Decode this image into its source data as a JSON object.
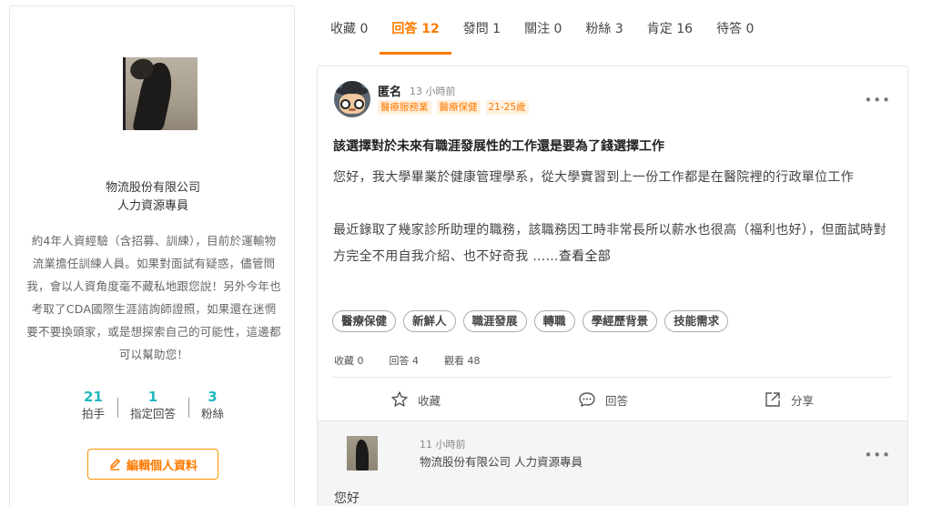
{
  "profile": {
    "company": "物流股份有限公司",
    "title": "人力資源專員",
    "bio": "約4年人資經驗（含招募、訓練），目前於運輸物流業擔任訓練人員。如果對面試有疑惑，儘管問我，會以人資角度毫不藏私地跟您說！另外今年也考取了CDA國際生涯諮詢師證照，如果還在迷惘要不要換頭家，或是想探索自己的可能性，這邊都可以幫助您！",
    "stats": [
      {
        "value": "21",
        "label": "拍手"
      },
      {
        "value": "1",
        "label": "指定回答"
      },
      {
        "value": "3",
        "label": "粉絲"
      }
    ],
    "edit_label": "編輯個人資料",
    "accent": "#21b8c1",
    "brand": "#ff7a00"
  },
  "tabs": [
    {
      "label": "收藏 0"
    },
    {
      "label": "回答 12",
      "active": true
    },
    {
      "label": "發問 1"
    },
    {
      "label": "關注 0"
    },
    {
      "label": "粉絲 3"
    },
    {
      "label": "肯定 16"
    },
    {
      "label": "待答 0"
    }
  ],
  "post": {
    "author": "匿名",
    "time": "13 小時前",
    "author_tags": [
      "醫療服務業",
      "醫療保健",
      "21-25歲"
    ],
    "title": "該選擇對於未來有職涯發展性的工作還是要為了錢選擇工作",
    "body_p1": "您好，我大學畢業於健康管理學系，從大學實習到上一份工作都是在醫院裡的行政單位工作",
    "body_p2": "最近錄取了幾家診所助理的職務，該職務因工時非常長所以薪水也很高（福利也好），但面試時對方完全不用自我介紹、也不好奇我 ……",
    "see_all": "查看全部",
    "topics": [
      "醫療保健",
      "新鮮人",
      "職涯發展",
      "轉職",
      "學經歷背景",
      "技能需求"
    ],
    "counts": {
      "fav": "收藏 0",
      "answers": "回答 4",
      "views": "觀看 48"
    },
    "actions": {
      "fav": "收藏",
      "reply": "回答",
      "share": "分享"
    }
  },
  "answer": {
    "time": "11 小時前",
    "author": "物流股份有限公司 人力資源專員",
    "body": "您好"
  }
}
